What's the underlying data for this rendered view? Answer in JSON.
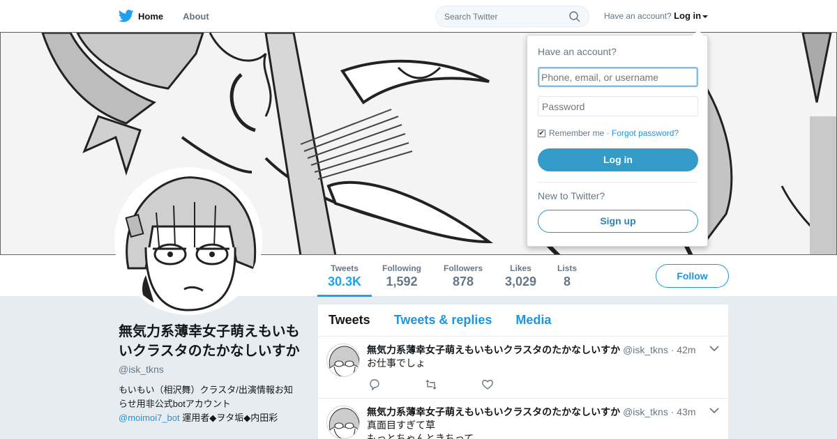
{
  "nav": {
    "home_label": "Home",
    "about_label": "About",
    "search_placeholder": "Search Twitter",
    "have_account_text": "Have an account?",
    "login_label": "Log in"
  },
  "login_dropdown": {
    "title": "Have an account?",
    "username_placeholder": "Phone, email, or username",
    "password_placeholder": "Password",
    "remember_label": "Remember me",
    "separator": "·",
    "forgot_label": "Forgot password?",
    "login_button": "Log in",
    "new_text": "New to Twitter?",
    "signup_button": "Sign up"
  },
  "stats": [
    {
      "label": "Tweets",
      "value": "30.3K"
    },
    {
      "label": "Following",
      "value": "1,592"
    },
    {
      "label": "Followers",
      "value": "878"
    },
    {
      "label": "Likes",
      "value": "3,029"
    },
    {
      "label": "Lists",
      "value": "8"
    }
  ],
  "follow_label": "Follow",
  "profile": {
    "name": "無気力系薄幸女子萌えもいもいクラスタのたかなしいすか",
    "handle": "@isk_tkns",
    "bio_prefix": "もいもい（相沢舞）クラスタ/出演情報お知らせ用非公式botアカウント",
    "bio_mention": "@moimoi7_bot",
    "bio_suffix": " 運用者◆ヲタ垢◆内田彩"
  },
  "timeline": {
    "tabs": [
      "Tweets",
      "Tweets & replies",
      "Media"
    ],
    "tweets": [
      {
        "name": "無気力系薄幸女子萌えもいもいクラスタのたかなしいすか",
        "handle": "@isk_tkns",
        "time": "· 42m",
        "text": "お仕事でしょ"
      },
      {
        "name": "無気力系薄幸女子萌えもいもいクラスタのたかなしいすか",
        "handle": "@isk_tkns",
        "time": "· 43m",
        "text": "真面目すぎて草",
        "text2": "もっとちゃんときちって"
      }
    ]
  },
  "colors": {
    "accent": "#1da1f2",
    "link": "#1b95e0",
    "login_button": "#349ac8",
    "background": "#e6ecf0"
  }
}
